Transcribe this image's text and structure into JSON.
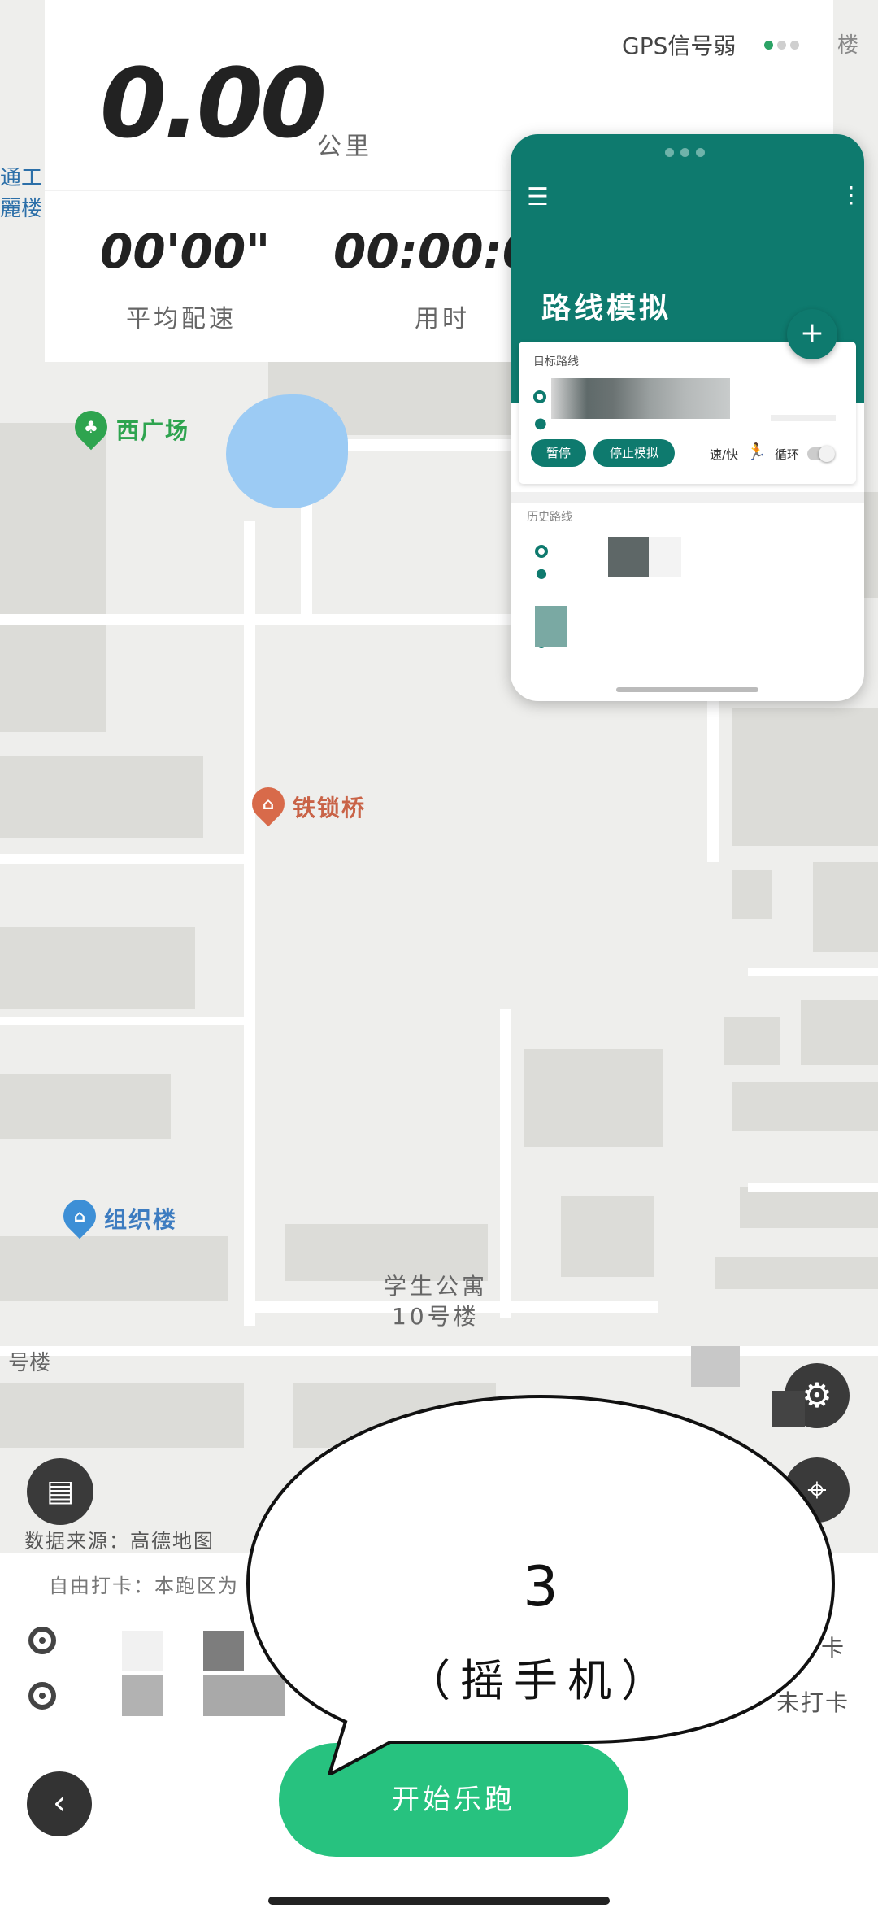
{
  "stats": {
    "distance": "0.00",
    "distance_unit": "公里",
    "gps_status": "GPS信号弱",
    "pace_value": "00'00\"",
    "pace_label": "平均配速",
    "time_value": "00:00:0",
    "time_label": "用时"
  },
  "map": {
    "poi_west_square": "西广场",
    "poi_bridge": "铁锁桥",
    "poi_building": "组织楼",
    "label_dorm_line1": "学生公寓",
    "label_dorm_line2": "10号楼",
    "label_left_edge": "号楼",
    "label_top_left_1": "通工",
    "label_top_left_2": "麗楼",
    "label_top_right": "楼"
  },
  "sim_window": {
    "title": "路线模拟",
    "target_route_label": "目标路线",
    "pause_button": "暂停",
    "stop_button": "停止模拟",
    "speed_label": "速/快",
    "loop_label": "循环",
    "history_label": "历史路线"
  },
  "bottom": {
    "data_source": "数据来源：高德地图",
    "free_checkin": "自由打卡：本跑区为",
    "checkin_right_1": "卡",
    "checkin_right_2": "未打卡",
    "start_button": "开始乐跑"
  },
  "overlay": {
    "number": "3",
    "text": "（摇手机）"
  },
  "colors": {
    "accent_green": "#27c27f",
    "sim_teal": "#0e7a6e",
    "gps_dot_on": "#2ca366"
  }
}
